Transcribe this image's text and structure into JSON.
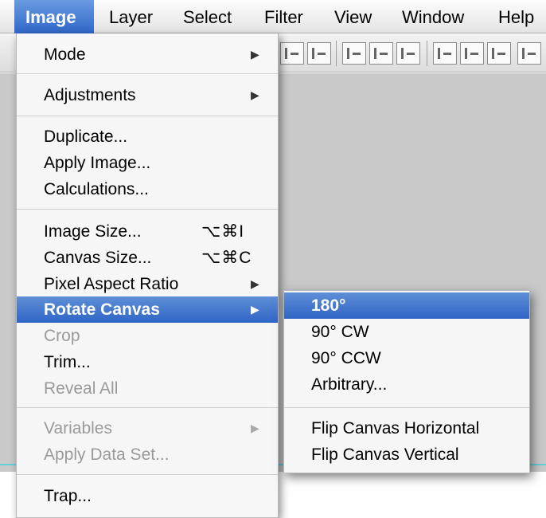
{
  "menubar": {
    "items": [
      {
        "label": "Image",
        "active": true
      },
      {
        "label": "Layer"
      },
      {
        "label": "Select"
      },
      {
        "label": "Filter"
      },
      {
        "label": "View"
      },
      {
        "label": "Window"
      },
      {
        "label": "Help"
      }
    ]
  },
  "image_menu": {
    "mode": "Mode",
    "adjustments": "Adjustments",
    "duplicate": "Duplicate...",
    "apply_image": "Apply Image...",
    "calculations": "Calculations...",
    "image_size": "Image Size...",
    "image_size_shortcut": "⌥⌘I",
    "canvas_size": "Canvas Size...",
    "canvas_size_shortcut": "⌥⌘C",
    "pixel_aspect_ratio": "Pixel Aspect Ratio",
    "rotate_canvas": "Rotate Canvas",
    "crop": "Crop",
    "trim": "Trim...",
    "reveal_all": "Reveal All",
    "variables": "Variables",
    "apply_data_set": "Apply Data Set...",
    "trap": "Trap...",
    "submenu_arrow": "▶"
  },
  "rotate_submenu": {
    "r180": "180°",
    "r90cw": "90° CW",
    "r90ccw": "90° CCW",
    "arbitrary": "Arbitrary...",
    "flip_horizontal": "Flip Canvas Horizontal",
    "flip_vertical": "Flip Canvas Vertical"
  },
  "colors": {
    "highlight": "#3a6fcf",
    "disabled_text": "#9a9a9a",
    "guide": "#63cfd8"
  }
}
